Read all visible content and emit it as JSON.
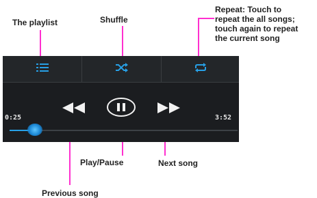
{
  "annotations": {
    "playlist": "The playlist",
    "shuffle": "Shuffle",
    "repeat_line1": "Repeat: Touch to",
    "repeat_line2": "repeat the all songs;",
    "repeat_line3": "touch again to repeat",
    "repeat_line4": "the current song",
    "play_pause": "Play/Pause",
    "next_song": "Next song",
    "previous_song": "Previous song"
  },
  "player": {
    "elapsed": "0:25",
    "duration": "3:52",
    "progress_fraction": 0.11,
    "accent_color": "#27a0e6",
    "leader_color": "#ff2fcf",
    "icons": [
      "playlist-icon",
      "shuffle-icon",
      "repeat-icon",
      "previous-icon",
      "pause-icon",
      "next-icon"
    ]
  }
}
